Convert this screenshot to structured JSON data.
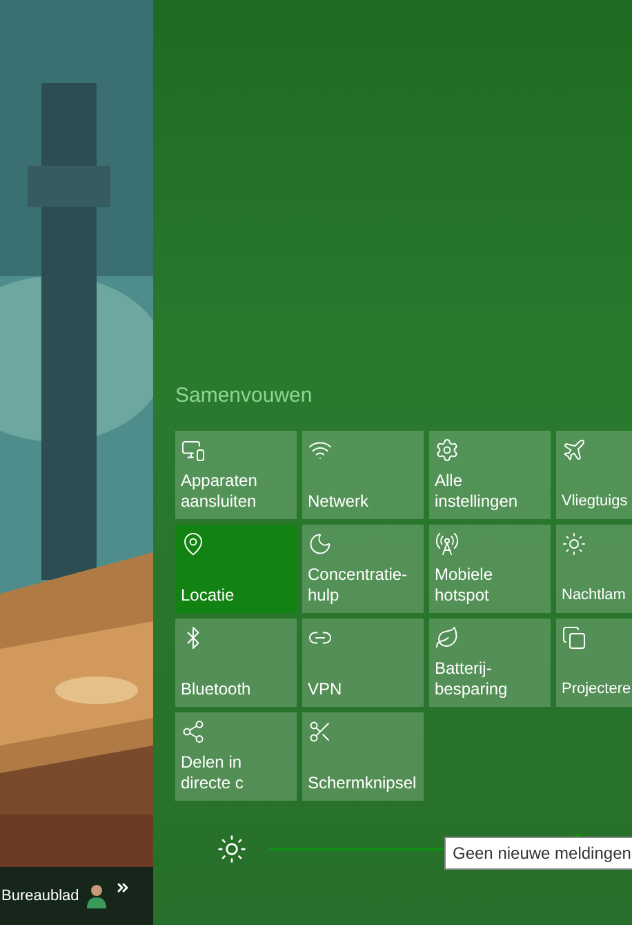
{
  "taskbar": {
    "label": "Bureaublad"
  },
  "action_center": {
    "collapse_link": "Samenvouwen",
    "tiles": [
      {
        "label": "Apparaten aansluiten",
        "selected": false
      },
      {
        "label": "Netwerk",
        "selected": false
      },
      {
        "label": "Alle instellingen",
        "selected": false
      },
      {
        "label": "Vliegtuigs",
        "selected": false
      },
      {
        "label": "Locatie",
        "selected": true
      },
      {
        "label": "Concentratie-hulp",
        "selected": false
      },
      {
        "label": "Mobiele hotspot",
        "selected": false
      },
      {
        "label": "Nachtlam",
        "selected": false
      },
      {
        "label": "Bluetooth",
        "selected": false
      },
      {
        "label": "VPN",
        "selected": false
      },
      {
        "label": "Batterij-besparing",
        "selected": false
      },
      {
        "label": "Projectere",
        "selected": false
      },
      {
        "label": "Delen in directe c",
        "selected": false
      },
      {
        "label": "Schermknipsel",
        "selected": false
      }
    ],
    "brightness": {
      "level": 0.85
    },
    "tooltip": "Geen nieuwe meldingen"
  }
}
